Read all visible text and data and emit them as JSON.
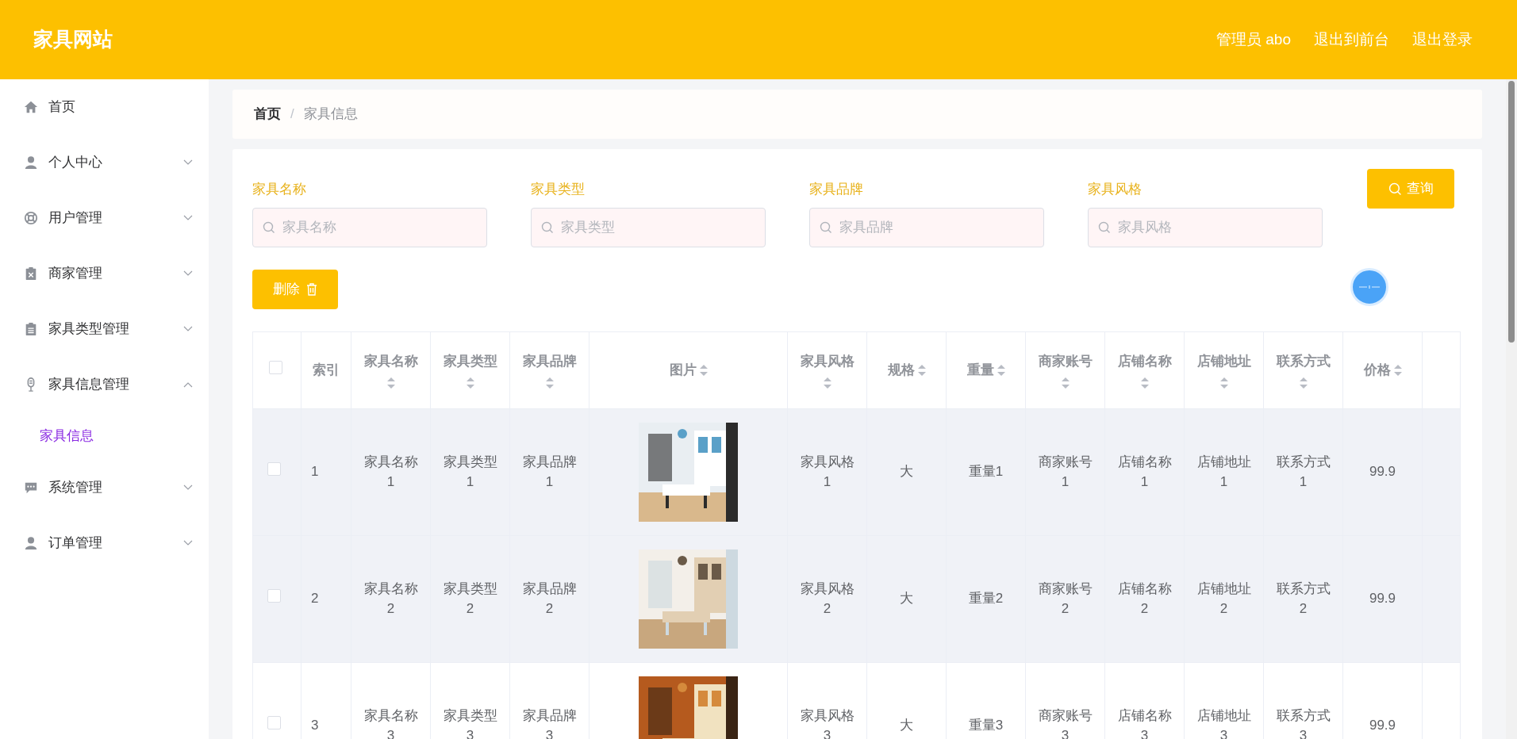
{
  "header": {
    "title": "家具网站",
    "links": [
      "管理员 abo",
      "退出到前台",
      "退出登录"
    ]
  },
  "sidebar": {
    "items": [
      {
        "label": "首页"
      },
      {
        "label": "个人中心",
        "expanded": false
      },
      {
        "label": "用户管理",
        "expanded": false
      },
      {
        "label": "商家管理",
        "expanded": false
      },
      {
        "label": "家具类型管理",
        "expanded": false
      },
      {
        "label": "家具信息管理",
        "expanded": true,
        "children": [
          {
            "label": "家具信息",
            "selected": true
          }
        ]
      },
      {
        "label": "系统管理",
        "expanded": false
      },
      {
        "label": "订单管理",
        "expanded": false
      }
    ]
  },
  "breadcrumb": [
    "首页",
    "/",
    "家具信息"
  ],
  "filters": [
    {
      "label": "家具名称",
      "placeholder": "家具名称"
    },
    {
      "label": "家具类型",
      "placeholder": "家具类型"
    },
    {
      "label": "家具品牌",
      "placeholder": "家具品牌"
    },
    {
      "label": "家具风格",
      "placeholder": "家具风格"
    }
  ],
  "search_button": "查询",
  "delete_button": "删除",
  "table": {
    "header_checked": false,
    "columns": [
      {
        "label": "索引",
        "sortable": false
      },
      {
        "label": "家具名称",
        "sortable": true
      },
      {
        "label": "家具类型",
        "sortable": true
      },
      {
        "label": "家具品牌",
        "sortable": true
      },
      {
        "label": "图片",
        "sortable": true
      },
      {
        "label": "家具风格",
        "sortable": true
      },
      {
        "label": "规格",
        "sortable": true
      },
      {
        "label": "重量",
        "sortable": true
      },
      {
        "label": "商家账号",
        "sortable": true
      },
      {
        "label": "店铺名称",
        "sortable": true
      },
      {
        "label": "店铺地址",
        "sortable": true
      },
      {
        "label": "联系方式",
        "sortable": true
      },
      {
        "label": "价格",
        "sortable": true
      }
    ],
    "rows": [
      {
        "checked": false,
        "highlighted": true,
        "cells": [
          "1",
          "家具名称1",
          "家具类型1",
          "家具品牌1",
          {
            "kind": "picture"
          },
          "家具风格1",
          "大",
          "重量1",
          "商家账号1",
          "店铺名称1",
          "店铺地址1",
          "联系方式1",
          "99.9"
        ]
      },
      {
        "checked": false,
        "highlighted": true,
        "cells": [
          "2",
          "家具名称2",
          "家具类型2",
          "家具品牌2",
          {
            "kind": "picture"
          },
          "家具风格2",
          "大",
          "重量2",
          "商家账号2",
          "店铺名称2",
          "店铺地址2",
          "联系方式2",
          "99.9"
        ]
      },
      {
        "checked": false,
        "highlighted": false,
        "cells": [
          "3",
          "家具名称3",
          "家具类型3",
          "家具品牌3",
          {
            "kind": "picture"
          },
          "家具风格3",
          "大",
          "重量3",
          "商家账号3",
          "店铺名称3",
          "店铺地址3",
          "联系方式3",
          "99.9"
        ]
      }
    ]
  }
}
